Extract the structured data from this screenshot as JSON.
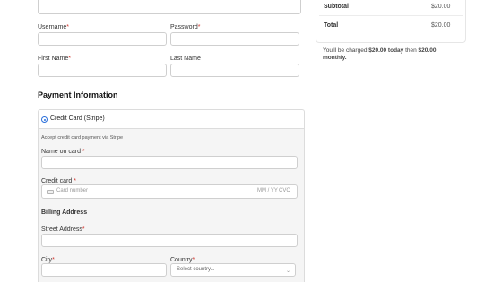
{
  "form": {
    "username_label": "Username",
    "password_label": "Password",
    "first_name_label": "First Name",
    "last_name_label": "Last Name",
    "required_mark": "*"
  },
  "payment": {
    "section_title": "Payment Information",
    "method_label": "Credit Card (Stripe)",
    "method_description": "Accept credit card payment via Stripe",
    "name_on_card_label": "Name on card",
    "credit_card_label": "Credit card",
    "card_number_placeholder": "Card number",
    "expiry_placeholder": "MM / YY",
    "cvc_placeholder": "CVC",
    "billing_title": "Billing Address",
    "street_label": "Street Address",
    "city_label": "City",
    "country_label": "Country",
    "country_value": "Select country..."
  },
  "summary": {
    "subtotal_label": "Subtotal",
    "subtotal_value": "$20.00",
    "total_label": "Total",
    "total_value": "$20.00",
    "charge_text_1": "You'll be charged ",
    "charge_amount_today": "$20.00 today",
    "charge_text_2": " then ",
    "charge_amount_monthly": "$20.00 monthly."
  }
}
